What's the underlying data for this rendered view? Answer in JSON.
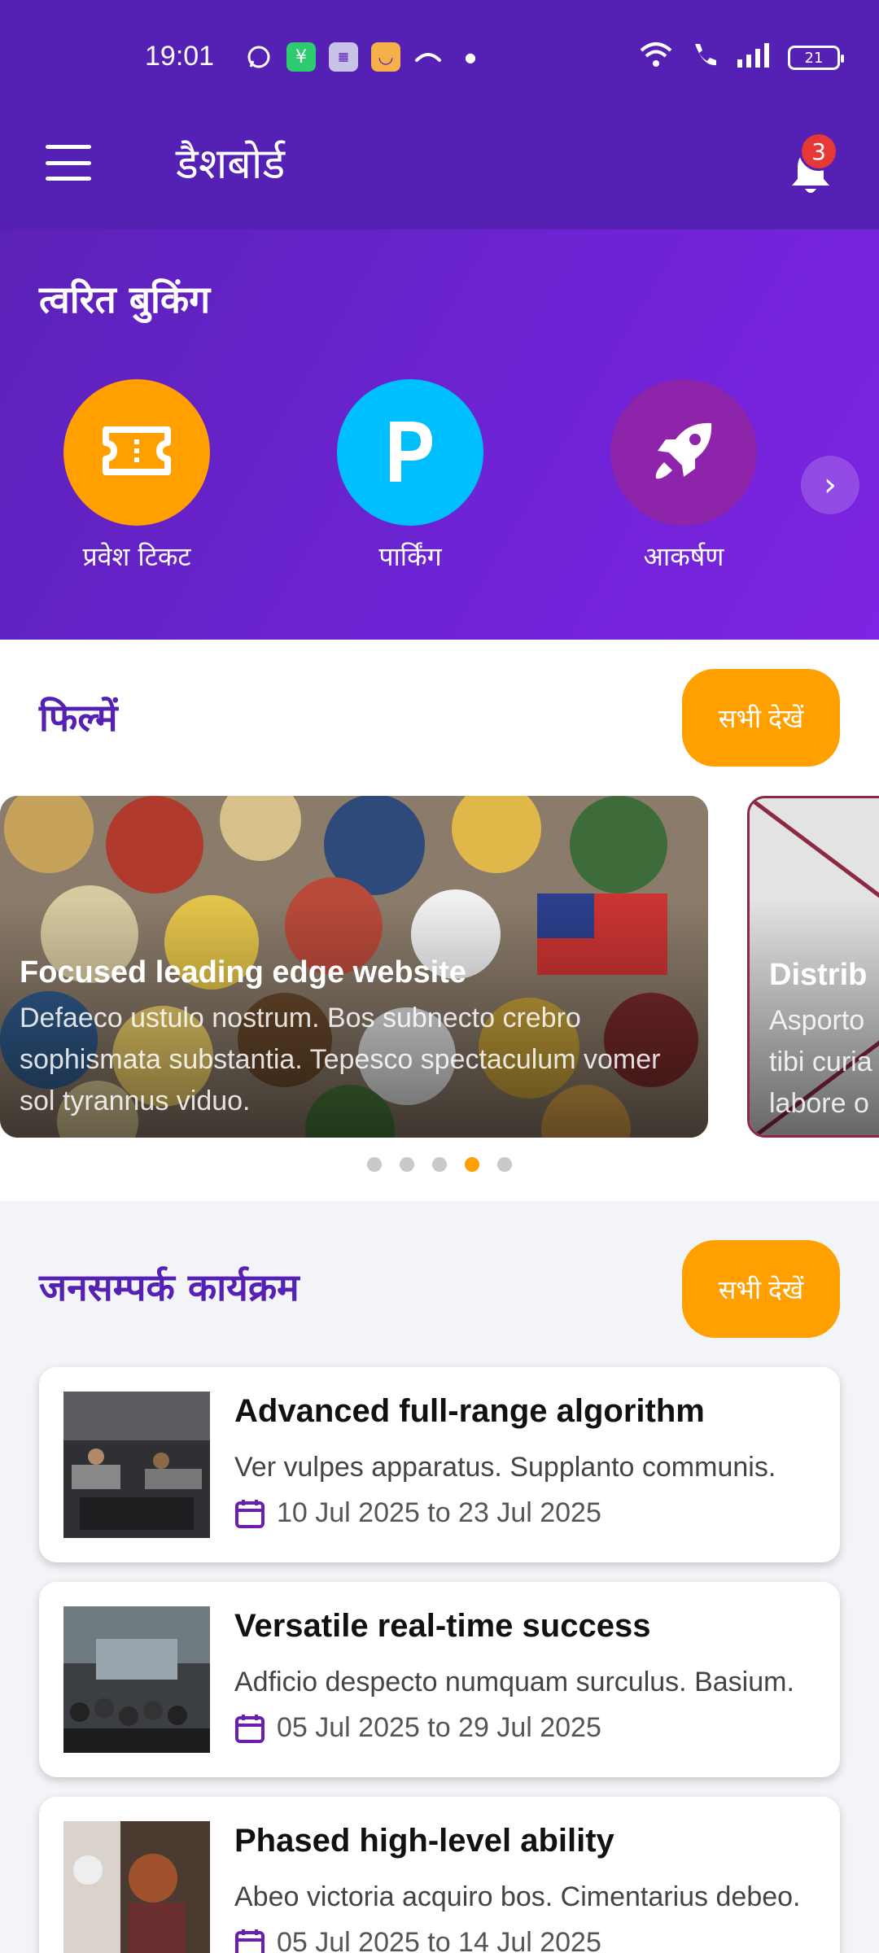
{
  "status": {
    "time": "19:01",
    "battery": "21"
  },
  "appbar": {
    "title": "डैशबोर्ड",
    "notification_count": "3"
  },
  "quick_booking": {
    "title": "त्वरित बुकिंग",
    "items": [
      {
        "label": "प्रवेश टिकट",
        "icon": "ticket-icon",
        "color": "#ffa000"
      },
      {
        "label": "पार्किंग",
        "icon": "parking-icon",
        "color": "#00bfff"
      },
      {
        "label": "आकर्षण",
        "icon": "rocket-icon",
        "color": "#8e24aa"
      }
    ]
  },
  "films": {
    "title": "फिल्में",
    "see_all": "सभी देखें",
    "cards": [
      {
        "title": "Focused leading edge website",
        "description": "Defaeco ustulo nostrum. Bos subnecto crebro sophismata substantia. Tepesco spectaculum vomer sol tyrannus viduo."
      },
      {
        "title": "Distrib",
        "description": "Asporto tibi curia labore o"
      }
    ],
    "carousel_active_index": 3,
    "carousel_count": 5
  },
  "events": {
    "title": "जनसम्पर्क कार्यक्रम",
    "see_all": "सभी देखें",
    "items": [
      {
        "title": "Advanced full-range algorithm",
        "description": "Ver vulpes apparatus. Supplanto communis.",
        "date": "10 Jul 2025 to 23 Jul 2025"
      },
      {
        "title": "Versatile real-time success",
        "description": "Adficio despecto numquam surculus. Basium.",
        "date": "05 Jul 2025 to 29 Jul 2025"
      },
      {
        "title": "Phased high-level ability",
        "description": "Abeo victoria acquiro bos. Cimentarius debeo.",
        "date": "05 Jul 2025 to 14 Jul 2025"
      }
    ]
  },
  "colors": {
    "primary": "#5521b5",
    "accent": "#ffa000"
  }
}
